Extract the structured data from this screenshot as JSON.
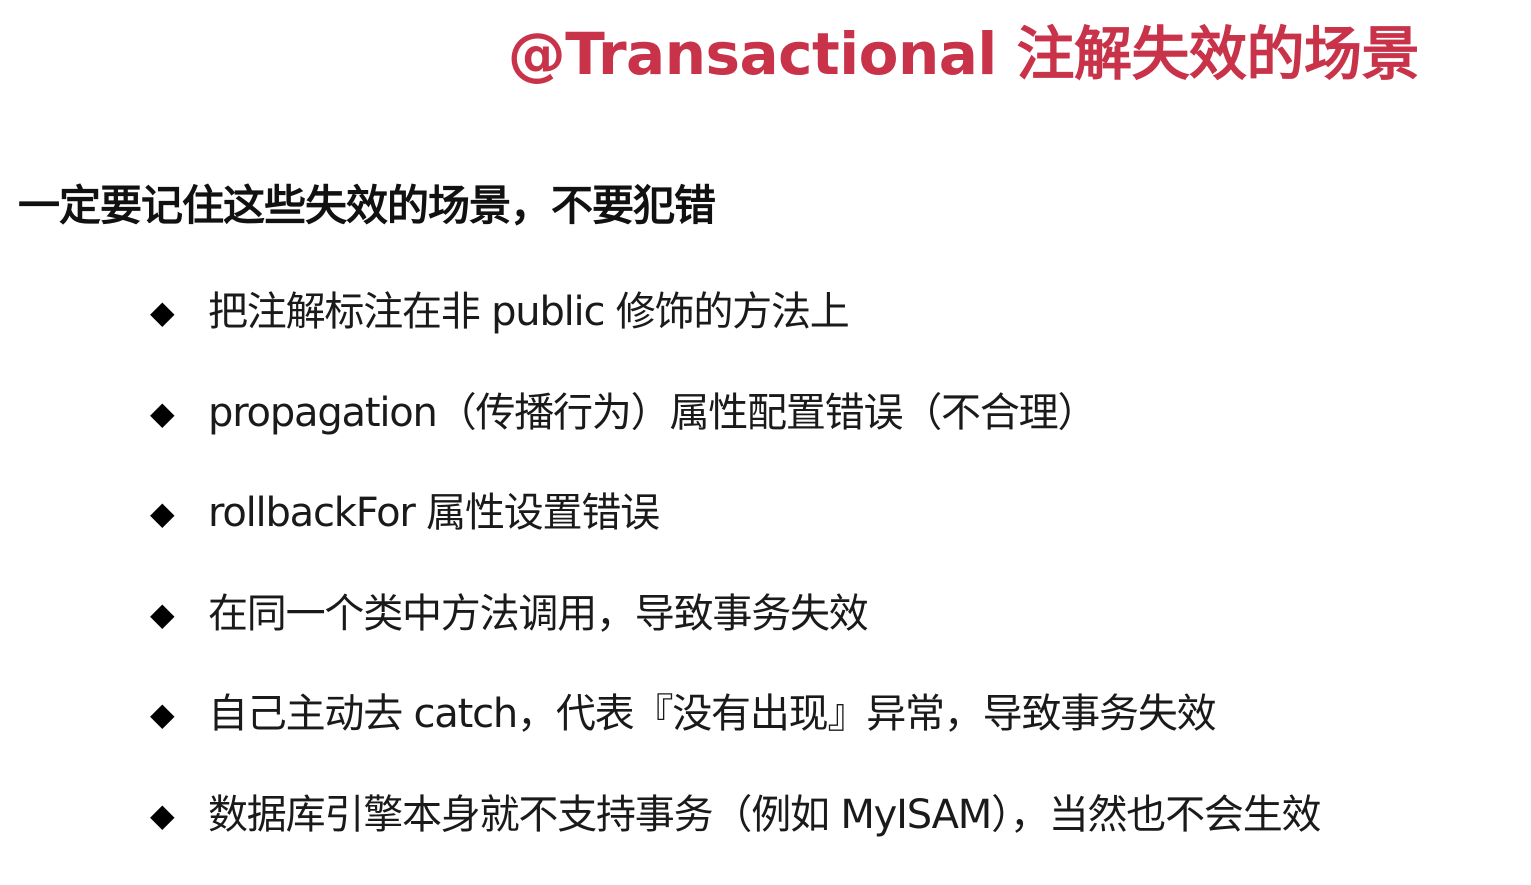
{
  "slide": {
    "title": "@Transactional 注解失效的场景",
    "title_color": "#c8334a",
    "subtitle": "一定要记住这些失效的场景，不要犯错",
    "bullet_marker": "◆",
    "items": [
      "把注解标注在非 public 修饰的方法上",
      "propagation（传播行为）属性配置错误（不合理）",
      "rollbackFor 属性设置错误",
      "在同一个类中方法调用，导致事务失效",
      "自己主动去 catch，代表『没有出现』异常，导致事务失效",
      "数据库引擎本身就不支持事务（例如 MyISAM），当然也不会生效"
    ]
  }
}
